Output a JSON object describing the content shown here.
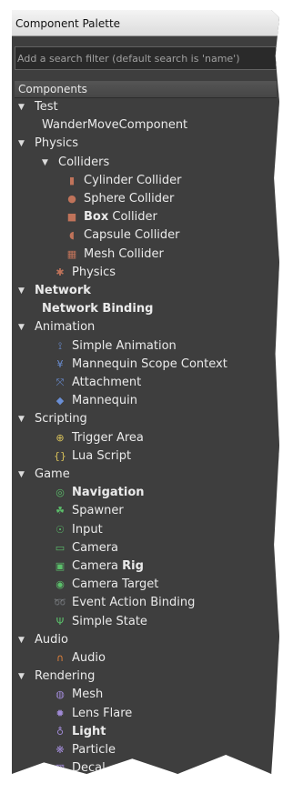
{
  "title": "Component Palette",
  "search": {
    "placeholder": "Add a search filter (default search is 'name')"
  },
  "tree_header": "Components",
  "tree": [
    {
      "depth": 0,
      "expander": "expanded",
      "label": "Test"
    },
    {
      "depth": 1,
      "label": "WanderMoveComponent"
    },
    {
      "depth": 0,
      "expander": "expanded",
      "label": "Physics"
    },
    {
      "depth": 1,
      "expander": "expanded",
      "label": "Colliders"
    },
    {
      "depth": 2,
      "icon": "cylinder-icon",
      "glyph": "▮",
      "icon_color": "#c0735a",
      "label": "Cylinder Collider"
    },
    {
      "depth": 2,
      "icon": "sphere-icon",
      "glyph": "●",
      "icon_color": "#c0735a",
      "label": "Sphere Collider"
    },
    {
      "depth": 2,
      "icon": "box-icon",
      "glyph": "■",
      "icon_color": "#c0735a",
      "label": "Box Collider",
      "bold": "Box"
    },
    {
      "depth": 2,
      "icon": "capsule-icon",
      "glyph": "◖",
      "icon_color": "#c0735a",
      "label": "Capsule Collider"
    },
    {
      "depth": 2,
      "icon": "mesh-collider-icon",
      "glyph": "▦",
      "icon_color": "#c0735a",
      "label": "Mesh Collider"
    },
    {
      "depth": 1.5,
      "icon": "physics-icon",
      "glyph": "✱",
      "icon_color": "#c0735a",
      "label": "Physics"
    },
    {
      "depth": 0,
      "expander": "expanded",
      "label": "Network",
      "bold": "Network"
    },
    {
      "depth": 1,
      "label": "Network Binding",
      "bold": "Network Binding"
    },
    {
      "depth": 0,
      "expander": "expanded",
      "label": "Animation"
    },
    {
      "depth": 1.5,
      "icon": "simple-animation-icon",
      "glyph": "⟟",
      "icon_color": "#6a8fd6",
      "label": "Simple Animation"
    },
    {
      "depth": 1.5,
      "icon": "mannequin-scope-icon",
      "glyph": "¥",
      "icon_color": "#6a8fd6",
      "label": "Mannequin Scope Context"
    },
    {
      "depth": 1.5,
      "icon": "attachment-icon",
      "glyph": "⤧",
      "icon_color": "#6a8fd6",
      "label": "Attachment"
    },
    {
      "depth": 1.5,
      "icon": "mannequin-icon",
      "glyph": "◆",
      "icon_color": "#6a8fd6",
      "label": "Mannequin"
    },
    {
      "depth": 0,
      "expander": "expanded",
      "label": "Scripting"
    },
    {
      "depth": 1.5,
      "icon": "trigger-area-icon",
      "glyph": "⊕",
      "icon_color": "#d9c25a",
      "label": "Trigger Area"
    },
    {
      "depth": 1.5,
      "icon": "lua-script-icon",
      "glyph": "{}",
      "icon_color": "#d9c25a",
      "label": "Lua Script"
    },
    {
      "depth": 0,
      "expander": "expanded",
      "label": "Game"
    },
    {
      "depth": 1.5,
      "icon": "navigation-icon",
      "glyph": "◎",
      "icon_color": "#5bbf6a",
      "label": "Navigation",
      "bold": "Navigation"
    },
    {
      "depth": 1.5,
      "icon": "spawner-icon",
      "glyph": "☘",
      "icon_color": "#5bbf6a",
      "label": "Spawner"
    },
    {
      "depth": 1.5,
      "icon": "input-icon",
      "glyph": "☉",
      "icon_color": "#5bbf6a",
      "label": "Input"
    },
    {
      "depth": 1.5,
      "icon": "camera-icon",
      "glyph": "▭",
      "icon_color": "#5bbf6a",
      "label": "Camera"
    },
    {
      "depth": 1.5,
      "icon": "camera-rig-icon",
      "glyph": "▣",
      "icon_color": "#5bbf6a",
      "label": "Camera Rig",
      "bold": "Rig"
    },
    {
      "depth": 1.5,
      "icon": "camera-target-icon",
      "glyph": "◉",
      "icon_color": "#5bbf6a",
      "label": "Camera Target"
    },
    {
      "depth": 1.5,
      "icon": "event-action-binding-icon",
      "glyph": "➿",
      "icon_color": "#5bbf6a",
      "label": "Event Action Binding"
    },
    {
      "depth": 1.5,
      "icon": "simple-state-icon",
      "glyph": "Ψ",
      "icon_color": "#5bbf6a",
      "label": "Simple State"
    },
    {
      "depth": 0,
      "expander": "expanded",
      "label": "Audio"
    },
    {
      "depth": 1.5,
      "icon": "audio-icon",
      "glyph": "∩",
      "icon_color": "#e0813a",
      "label": "Audio"
    },
    {
      "depth": 0,
      "expander": "expanded",
      "label": "Rendering"
    },
    {
      "depth": 1.5,
      "icon": "mesh-icon",
      "glyph": "◍",
      "icon_color": "#a08ad6",
      "label": "Mesh"
    },
    {
      "depth": 1.5,
      "icon": "lens-flare-icon",
      "glyph": "✹",
      "icon_color": "#a08ad6",
      "label": "Lens Flare"
    },
    {
      "depth": 1.5,
      "icon": "light-icon",
      "glyph": "♁",
      "icon_color": "#a08ad6",
      "label": "Light",
      "bold": "Light"
    },
    {
      "depth": 1.5,
      "icon": "particle-icon",
      "glyph": "❋",
      "icon_color": "#a08ad6",
      "label": "Particle"
    },
    {
      "depth": 1.5,
      "icon": "decal-icon",
      "glyph": "▧",
      "icon_color": "#a08ad6",
      "label": "Decal"
    }
  ]
}
